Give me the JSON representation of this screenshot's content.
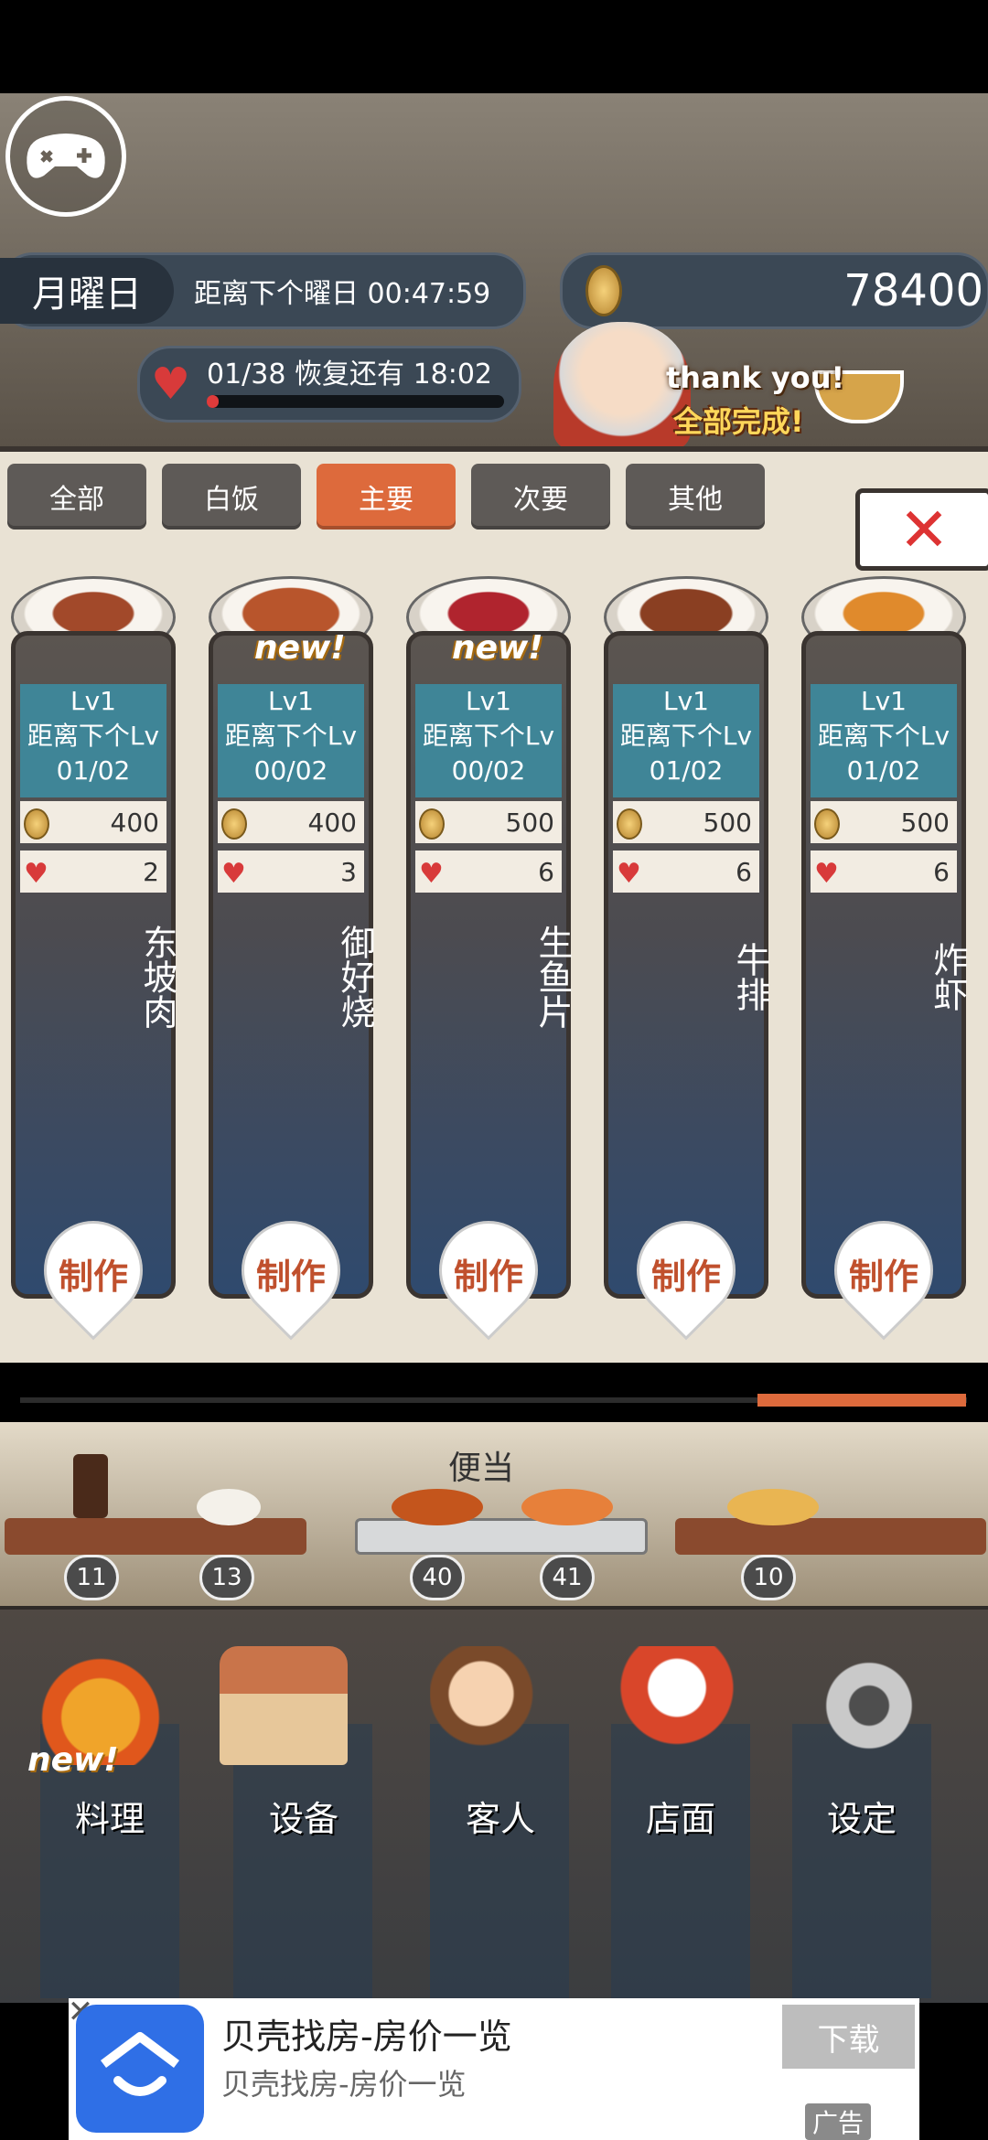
{
  "status": {
    "day": "月曜日",
    "countdown": "距离下个曜日 00:47:59",
    "coins": "78400",
    "life": "01/38",
    "recover_label": "恢复还有",
    "recover_time": "18:02",
    "life_fraction": 0.026
  },
  "banner": {
    "thank_you": "thank you!",
    "all_done": "全部完成!"
  },
  "tabs": [
    {
      "label": "全部"
    },
    {
      "label": "白饭"
    },
    {
      "label": "主要"
    },
    {
      "label": "次要"
    },
    {
      "label": "其他"
    }
  ],
  "cards": [
    {
      "name": "东坡肉",
      "level": "Lv1",
      "next_label": "距离下个Lv",
      "progress": "01/02",
      "price": "400",
      "hearts": "2",
      "new": "",
      "make": "制作"
    },
    {
      "name": "御好烧",
      "level": "Lv1",
      "next_label": "距离下个Lv",
      "progress": "00/02",
      "price": "400",
      "hearts": "3",
      "new": "new!",
      "make": "制作"
    },
    {
      "name": "生鱼片",
      "level": "Lv1",
      "next_label": "距离下个Lv",
      "progress": "00/02",
      "price": "500",
      "hearts": "6",
      "new": "new!",
      "make": "制作"
    },
    {
      "name": "牛排",
      "level": "Lv1",
      "next_label": "距离下个Lv",
      "progress": "01/02",
      "price": "500",
      "hearts": "6",
      "new": "",
      "make": "制作"
    },
    {
      "name": "炸虾",
      "level": "Lv1",
      "next_label": "距离下个Lv",
      "progress": "01/02",
      "price": "500",
      "hearts": "6",
      "new": "",
      "make": "制作"
    }
  ],
  "bento": {
    "label": "便当",
    "counts": [
      "11",
      "13",
      "40",
      "41",
      "10"
    ]
  },
  "nav": [
    {
      "label": "料理",
      "new": "new!"
    },
    {
      "label": "设备"
    },
    {
      "label": "客人"
    },
    {
      "label": "店面"
    },
    {
      "label": "设定"
    }
  ],
  "ad": {
    "title": "贝壳找房-房价一览",
    "subtitle": "贝壳找房-房价一览",
    "button": "下载",
    "tag": "广告",
    "close": "✕"
  },
  "colors": {
    "accent": "#dd6a3c",
    "tab": "#5e5a57",
    "card_info": "#3f8597",
    "heart": "#d83a3a"
  }
}
